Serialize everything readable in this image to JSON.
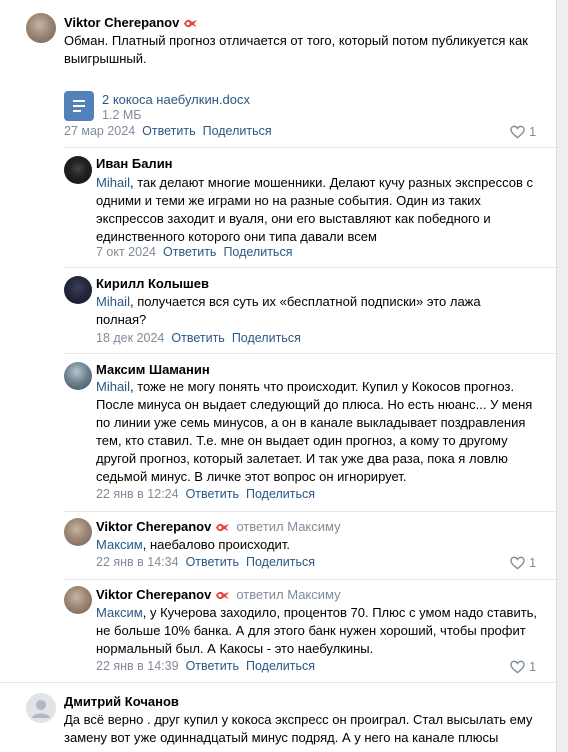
{
  "main_comment": {
    "author": "Viktor Cherepanov",
    "text": "Обман. Платный прогноз отличается от того, который потом публикуется как выигрышный.",
    "attachment": {
      "title": "2 кокоса наебулкин.docx",
      "size": "1.2 МБ"
    },
    "date": "27 мар 2024",
    "reply_label": "Ответить",
    "share_label": "Поделиться",
    "likes": "1"
  },
  "replies": [
    {
      "author": "Иван Балин",
      "mention": "Mihail",
      "text": ", так делают многие мошенники. Делают кучу разных экспрессов с одними и теми же играми но на разные события. Один из таких экспрессов заходит и вуаля, они его выставляют как победного и единственного которого они типа давали всем",
      "date": "7 окт 2024",
      "reply_label": "Ответить",
      "share_label": "Поделиться"
    },
    {
      "author": "Кирилл Колышев",
      "mention": "Mihail",
      "text": ", получается вся суть их «бесплатной подписки» это лажа полная?",
      "date": "18 дек 2024",
      "reply_label": "Ответить",
      "share_label": "Поделиться"
    },
    {
      "author": "Максим Шаманин",
      "mention": "Mihail",
      "text": ", тоже не могу понять что происходит. Купил у Кокосов прогноз. После минуса он выдает следующий до плюса. Но есть нюанс... У меня по линии уже семь минусов, а он в канале выкладывает поздравления тем, кто ставил. Т.е. мне он выдает один прогноз, а кому то другому другой прогноз, который залетает. И так уже два раза, пока я ловлю седьмой минус. В личке этот вопрос он игнорирует.",
      "date": "22 янв в 12:24",
      "reply_label": "Ответить",
      "share_label": "Поделиться"
    },
    {
      "author": "Viktor Cherepanov",
      "replied_to": "ответил Максиму",
      "mention": "Максим",
      "text": ", наебалово происходит.",
      "date": "22 янв в 14:34",
      "reply_label": "Ответить",
      "share_label": "Поделиться",
      "likes": "1"
    },
    {
      "author": "Viktor Cherepanov",
      "replied_to": "ответил Максиму",
      "mention": "Максим",
      "text": ", у Кучерова заходило, процентов 70. Плюс с умом надо ставить, не больше 10% банка. А для этого банк нужен хороший, чтобы профит нормальный был. А Какосы - это наебулкины.",
      "date": "22 янв в 14:39",
      "reply_label": "Ответить",
      "share_label": "Поделиться",
      "likes": "1"
    }
  ],
  "next_comment": {
    "author": "Дмитрий Кочанов",
    "text": "Да всё верно . друг купил у кокоса экспресс он проиграл. Стал высылать ему замену вот уже одиннадцатый минус подряд. А у него на канале плюсы"
  },
  "colors": {
    "link": "#2a5885",
    "meta": "#818c99",
    "badge": "#e64646",
    "doc_icon": "#5181b8"
  }
}
